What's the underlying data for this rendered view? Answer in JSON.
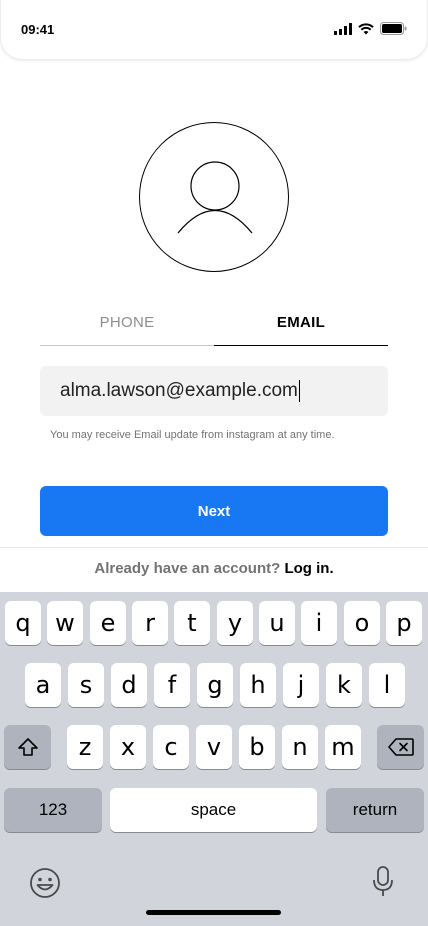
{
  "status_bar": {
    "time": "09:41"
  },
  "tabs": [
    {
      "label": "PHONE",
      "active": false
    },
    {
      "label": "EMAIL",
      "active": true
    }
  ],
  "email_input": {
    "value": "alma.lawson@example.com"
  },
  "helper_text": "You may receive Email update from instagram at any time.",
  "next_button": {
    "label": "Next",
    "color": "#1877f2"
  },
  "login": {
    "prompt": "Already have an account?",
    "link": "Log in."
  },
  "keyboard": {
    "row1": [
      "q",
      "w",
      "e",
      "r",
      "t",
      "y",
      "u",
      "i",
      "o",
      "p"
    ],
    "row2": [
      "a",
      "s",
      "d",
      "f",
      "g",
      "h",
      "j",
      "k",
      "l"
    ],
    "row3": [
      "z",
      "x",
      "c",
      "v",
      "b",
      "n",
      "m"
    ],
    "numbers_key": "123",
    "space_key": "space",
    "return_key": "return"
  },
  "icons": [
    "signal-icon",
    "wifi-icon",
    "battery-icon",
    "profile-icon",
    "shift-icon",
    "backspace-icon",
    "emoji-icon",
    "microphone-icon"
  ]
}
